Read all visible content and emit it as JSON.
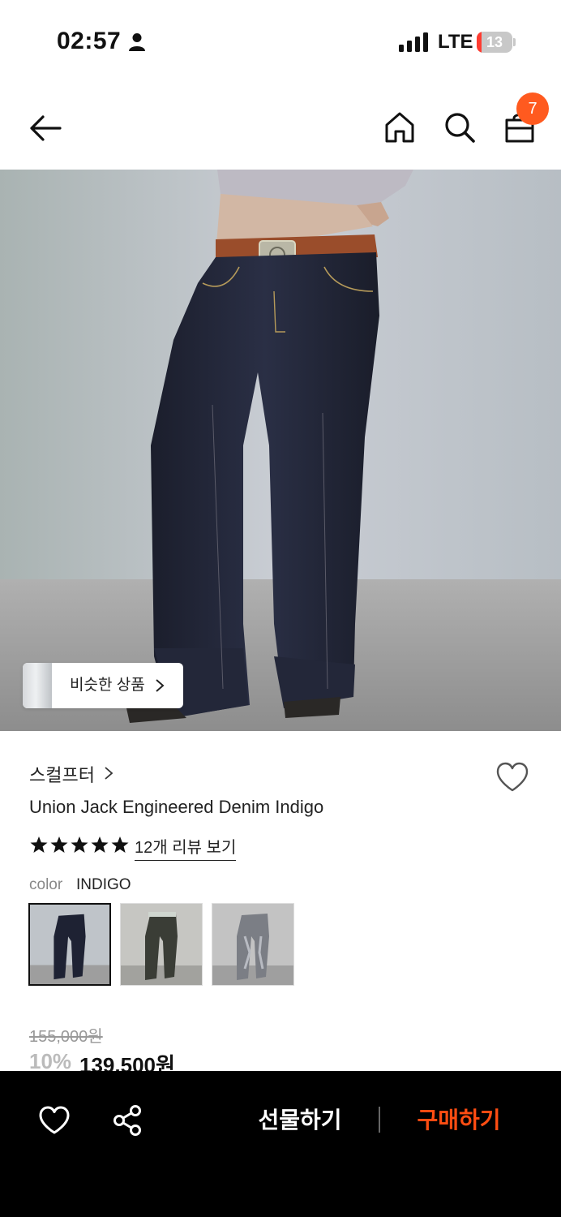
{
  "status_bar": {
    "time": "02:57",
    "network": "LTE",
    "battery_level": "13",
    "battery_fraction": 0.13,
    "icons": [
      "person-icon",
      "signal-icon",
      "battery-icon"
    ]
  },
  "nav": {
    "icons": [
      "back-arrow-icon",
      "home-icon",
      "search-icon",
      "cart-icon"
    ],
    "cart_count": "7"
  },
  "hero": {
    "similar_label": "비슷한 상품"
  },
  "product": {
    "brand": "스컬프터",
    "name": "Union Jack Engineered Denim Indigo",
    "rating_stars": 5,
    "review_link": "12개 리뷰 보기",
    "color_label": "color",
    "color_value": "INDIGO",
    "selected_swatch": 1,
    "original_price": "155,000원",
    "discount": "10%",
    "final_price": "139,500원"
  },
  "bottom_bar": {
    "icons": [
      "heart-icon",
      "share-icon"
    ],
    "gift_label": "선물하기",
    "buy_label": "구매하기"
  },
  "colors": {
    "accent": "#ff5a1f",
    "buy": "#ff4d12",
    "bottom_bar_bg": "#000000",
    "battery_low": "#ff3b30"
  }
}
